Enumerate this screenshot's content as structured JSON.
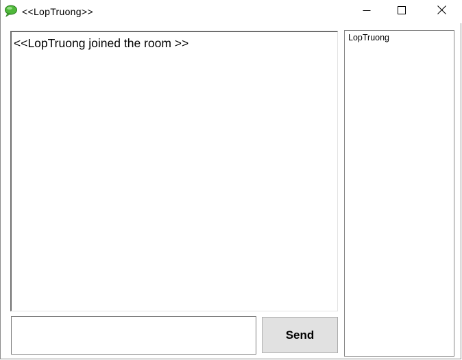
{
  "window": {
    "title": "<<LopTruong>>",
    "icon": "chat-bubble-icon",
    "controls": {
      "minimize_icon": "minimize-icon",
      "maximize_icon": "maximize-icon",
      "close_icon": "close-icon"
    }
  },
  "chat": {
    "messages": [
      "<<LopTruong joined the room >>"
    ]
  },
  "input": {
    "value": ""
  },
  "send": {
    "label": "Send"
  },
  "users": {
    "items": [
      "LopTruong"
    ]
  },
  "colors": {
    "icon_green": "#3fa22f",
    "button_face": "#e1e1e1",
    "border": "#828282"
  }
}
